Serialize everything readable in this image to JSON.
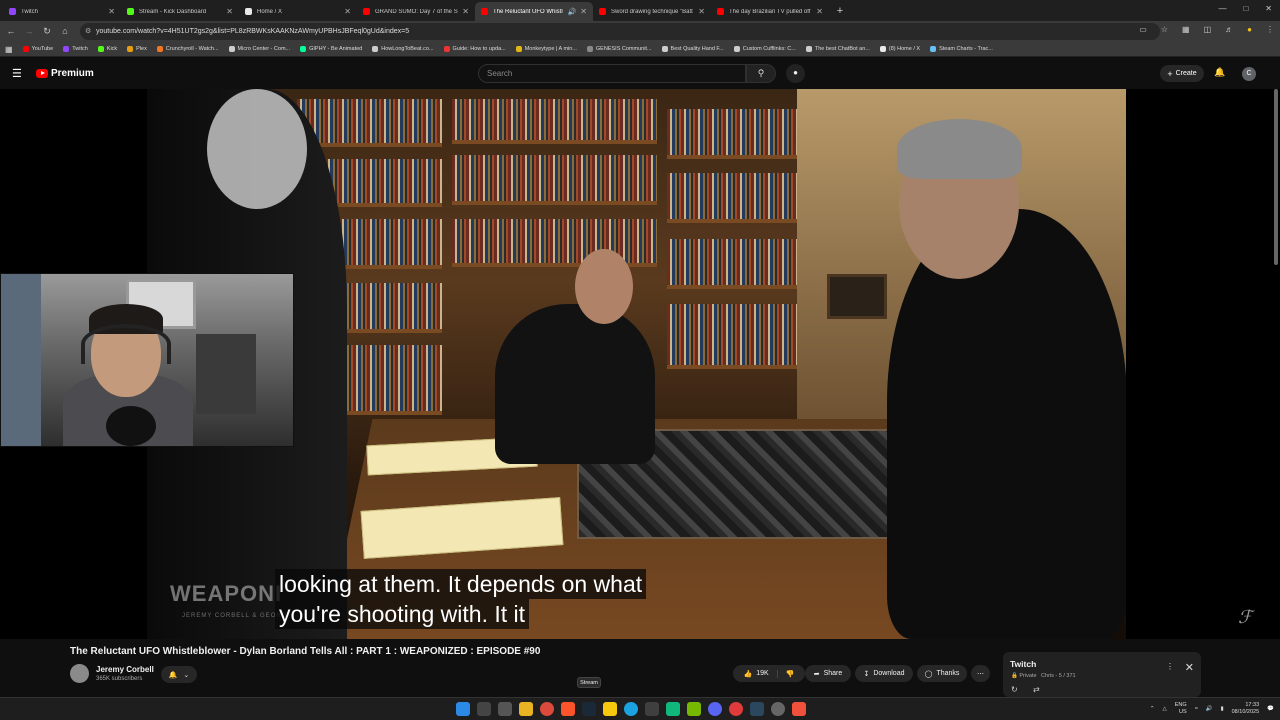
{
  "tabs": [
    {
      "label": "Twitch",
      "color": "#9146ff",
      "active": false
    },
    {
      "label": "Stream - Kick Dashboard",
      "color": "#53fc18",
      "active": false
    },
    {
      "label": "Home / X",
      "color": "#e7e9ea",
      "active": false
    },
    {
      "label": "GRAND SUMO: Day 7 of the Se",
      "color": "#ff0000",
      "active": false
    },
    {
      "label": "The Reluctant UFO Whistl",
      "color": "#ff0000",
      "active": true
    },
    {
      "label": "Sword drawing technique \"Batt",
      "color": "#ff0000",
      "active": false
    },
    {
      "label": "The day Brazilian TV pulled off",
      "color": "#ff0000",
      "active": false
    }
  ],
  "new_tab": "+",
  "url": "youtube.com/watch?v=4H51UT2gs2g&list=PL8zRBWKsKAAKNzAWmyUPBHsJBFeql0gUd&index=5",
  "bookmarks": [
    {
      "label": "YouTube",
      "color": "#ff0000"
    },
    {
      "label": "Twitch",
      "color": "#9146ff"
    },
    {
      "label": "Kick",
      "color": "#53fc18"
    },
    {
      "label": "Plex",
      "color": "#e5a00d"
    },
    {
      "label": "Crunchyroll - Watch...",
      "color": "#f47521"
    },
    {
      "label": "Micro Center - Com...",
      "color": "#cccccc"
    },
    {
      "label": "GIPHY - Be Animated",
      "color": "#00ff99"
    },
    {
      "label": "HowLongToBeat.co...",
      "color": "#cccccc"
    },
    {
      "label": "Guide: How to upda...",
      "color": "#e33"
    },
    {
      "label": "Monkeytype | A min...",
      "color": "#e2b714"
    },
    {
      "label": "GENESIS Communit...",
      "color": "#888888"
    },
    {
      "label": "Best Quality Hand F...",
      "color": "#cccccc"
    },
    {
      "label": "Custom Cufflinks: C...",
      "color": "#cccccc"
    },
    {
      "label": "The best ChatBot an...",
      "color": "#cccccc"
    },
    {
      "label": "(8) Home / X",
      "color": "#e7e9ea"
    },
    {
      "label": "Steam Charts - Trac...",
      "color": "#66c0f4"
    }
  ],
  "youtube": {
    "logo_text": "Premium",
    "search_placeholder": "Search",
    "create_label": "Create",
    "avatar_letter": "C"
  },
  "video": {
    "captions": [
      "looking at them. It depends on what",
      "you're shooting with. It it"
    ],
    "title": "The Reluctant UFO Whistleblower - Dylan Borland Tells All : PART 1 : WEAPONIZED : EPISODE #90",
    "channel": "Jeremy Corbell",
    "subscribers": "365K subscribers",
    "likes": "19K",
    "share": "Share",
    "download": "Download",
    "thanks": "Thanks"
  },
  "twitch_mini": {
    "title": "Twitch",
    "privacy": "Private",
    "info": "Chris - 5 / 371"
  },
  "tooltip": "Stream",
  "tray": {
    "lang": "ENG",
    "region": "US",
    "time": "17:33",
    "date": "08/10/2025"
  }
}
